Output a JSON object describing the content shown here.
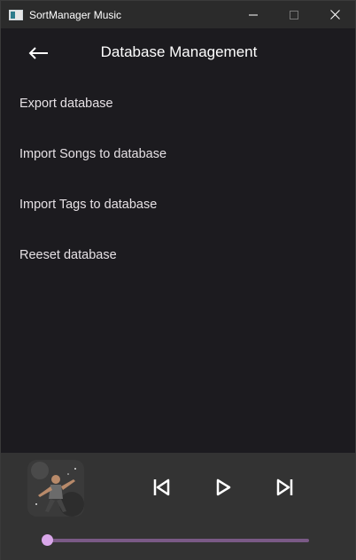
{
  "window": {
    "title": "SortManager Music",
    "icon": "app-window-icon",
    "controls": [
      "minimize-icon",
      "maximize-icon",
      "close-icon"
    ]
  },
  "header": {
    "back_icon": "arrow-left-icon",
    "title": "Database Management"
  },
  "menu": {
    "items": [
      {
        "label": "Export database"
      },
      {
        "label": "Import Songs to database"
      },
      {
        "label": "Import Tags to database"
      },
      {
        "label": "Reeset database"
      }
    ]
  },
  "player": {
    "album_art": "album-cover-image",
    "controls": [
      "skip-previous-icon",
      "play-icon",
      "skip-next-icon"
    ],
    "progress": 0.0
  },
  "colors": {
    "background": "#1c1b1f",
    "titlebar": "#2b2b2b",
    "player_bg": "#333333",
    "accent": "#d9a7ea",
    "track": "#7a5a86",
    "text": "#e6e1e5"
  }
}
